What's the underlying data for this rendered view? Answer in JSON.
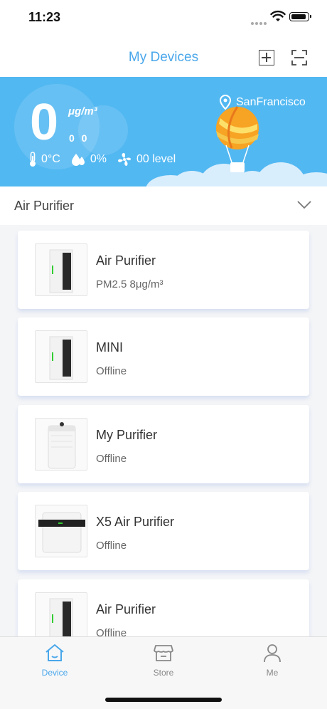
{
  "status_bar": {
    "time": "11:23"
  },
  "nav": {
    "title": "My Devices",
    "add_icon": "plus-square-icon",
    "scan_icon": "scan-icon"
  },
  "hero": {
    "aqi_value": "0",
    "aqi_unit": "μg/m³",
    "aqi_sub": "0 0",
    "temperature": "0°C",
    "humidity": "0%",
    "fan_level": "00 level",
    "location": "SanFrancisco",
    "colors": {
      "background": "#52b8f2",
      "cloud": "#d9eefc"
    }
  },
  "group": {
    "title": "Air Purifier"
  },
  "devices": [
    {
      "name": "Air Purifier",
      "status": "PM2.5 8μg/m³"
    },
    {
      "name": "MINI",
      "status": "Offline"
    },
    {
      "name": "My Purifier",
      "status": "Offline"
    },
    {
      "name": "X5 Air Purifier",
      "status": "Offline"
    },
    {
      "name": "Air Purifier",
      "status": "Offline"
    }
  ],
  "tabs": [
    {
      "label": "Device",
      "icon": "home-icon",
      "active": true
    },
    {
      "label": "Store",
      "icon": "store-icon",
      "active": false
    },
    {
      "label": "Me",
      "icon": "person-icon",
      "active": false
    }
  ],
  "accent_color": "#4aa7ea"
}
